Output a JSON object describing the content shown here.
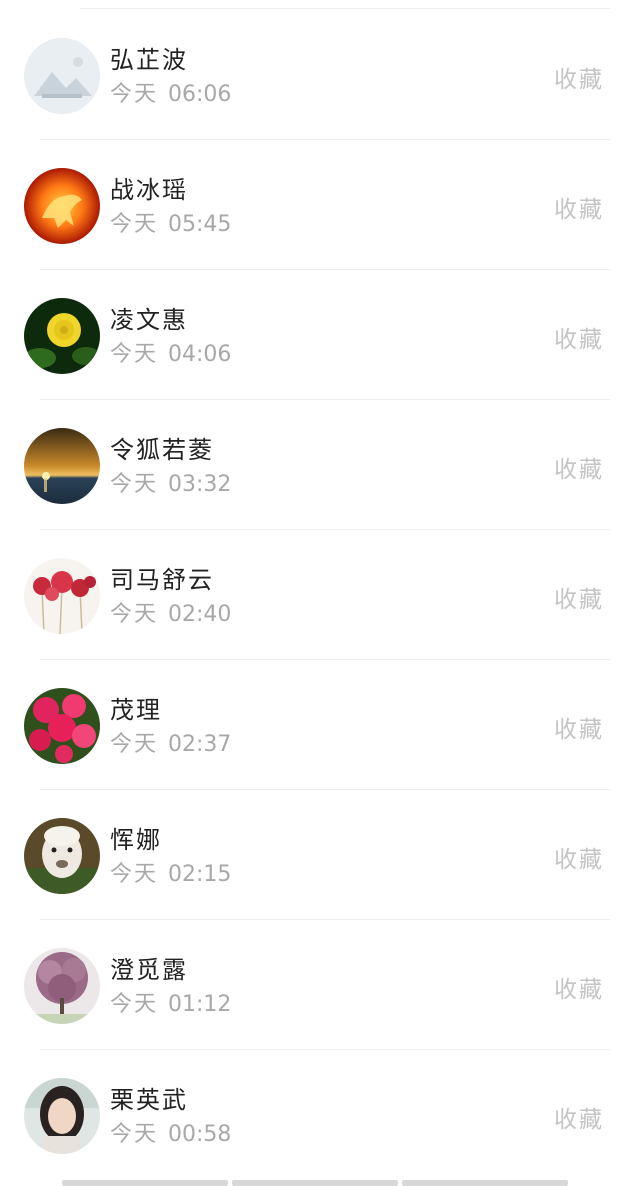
{
  "contacts": [
    {
      "name": "弘芷波",
      "day": "今天",
      "time": "06:06",
      "action": "收藏",
      "avatar": "landscape-placeholder-avatar"
    },
    {
      "name": "战冰瑶",
      "day": "今天",
      "time": "05:45",
      "action": "收藏",
      "avatar": "fire-horse-avatar"
    },
    {
      "name": "凌文惠",
      "day": "今天",
      "time": "04:06",
      "action": "收藏",
      "avatar": "yellow-rose-avatar"
    },
    {
      "name": "令狐若菱",
      "day": "今天",
      "time": "03:32",
      "action": "收藏",
      "avatar": "sunset-sea-avatar"
    },
    {
      "name": "司马舒云",
      "day": "今天",
      "time": "02:40",
      "action": "收藏",
      "avatar": "red-flowers-avatar"
    },
    {
      "name": "茂理",
      "day": "今天",
      "time": "02:37",
      "action": "收藏",
      "avatar": "pink-flowers-avatar"
    },
    {
      "name": "恽娜",
      "day": "今天",
      "time": "02:15",
      "action": "收藏",
      "avatar": "alpaca-avatar"
    },
    {
      "name": "澄觅露",
      "day": "今天",
      "time": "01:12",
      "action": "收藏",
      "avatar": "blossom-tree-avatar"
    },
    {
      "name": "栗英武",
      "day": "今天",
      "time": "00:58",
      "action": "收藏",
      "avatar": "woman-portrait-avatar"
    }
  ]
}
